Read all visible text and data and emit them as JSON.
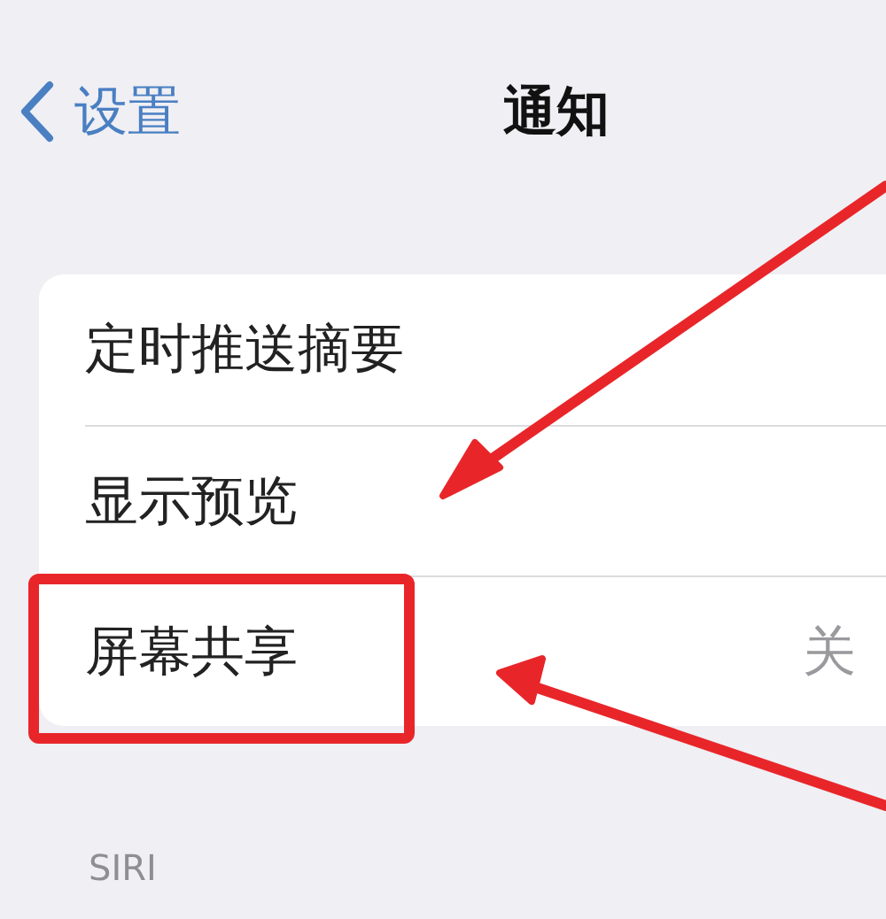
{
  "nav": {
    "back": "设置",
    "title": "通知"
  },
  "rows": [
    {
      "label": "定时推送摘要",
      "highlighted": false
    },
    {
      "label": "显示预览",
      "highlighted": false
    },
    {
      "label": "屏幕共享",
      "value": "关",
      "highlighted": true
    }
  ],
  "section_header": "SIRI"
}
